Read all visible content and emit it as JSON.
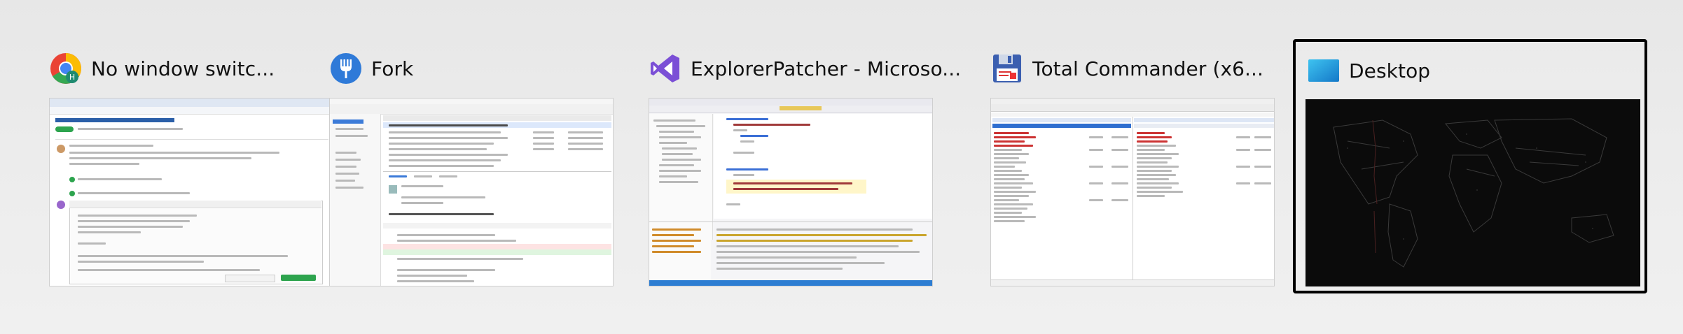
{
  "switcher": {
    "tiles": [
      {
        "title": "No window switc...",
        "app": "Google Chrome",
        "icon": "chrome-icon",
        "selected": false
      },
      {
        "title": "Fork",
        "app": "Fork",
        "icon": "fork-icon",
        "selected": false
      },
      {
        "title": "ExplorerPatcher - Microso...",
        "app": "Visual Studio",
        "icon": "visual-studio-icon",
        "selected": false
      },
      {
        "title": "Total Commander (x6...",
        "app": "Total Commander",
        "icon": "total-commander-icon",
        "selected": false
      },
      {
        "title": "Desktop",
        "app": "Desktop",
        "icon": "desktop-icon",
        "selected": true
      }
    ]
  },
  "colors": {
    "chrome_red": "#EA4335",
    "chrome_yellow": "#FBBC05",
    "chrome_green": "#34A853",
    "chrome_blue": "#4285F4",
    "fork_blue": "#2f7ad8",
    "vs_purple": "#7b4fd6",
    "tc_blue": "#3b5fb0",
    "desktop_blue": "#1f9be0",
    "selection_border": "#000000"
  }
}
